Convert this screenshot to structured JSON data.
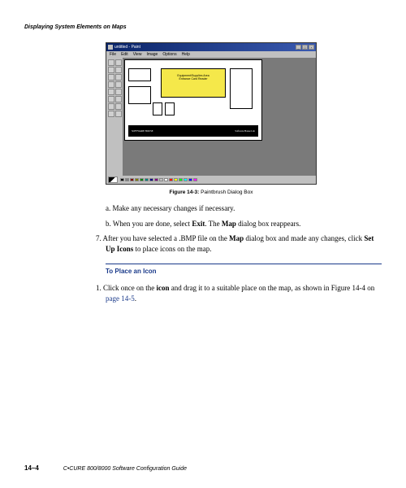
{
  "header": {
    "title": "Displaying System Elements on Maps"
  },
  "figure": {
    "window_title": "untitled - Paint",
    "menu": [
      "File",
      "Edit",
      "View",
      "Image",
      "Options",
      "Help"
    ],
    "caption_label": "Figure 14-3:",
    "caption_text": "Paintbrush Dialog Box",
    "rooms": {
      "highlight_line1": "Equipment/Supplies Area",
      "highlight_line2": "Entrance Card Reader"
    },
    "footer_left": "SOFTWARE HOUSE",
    "footer_right": "Software House Lab"
  },
  "steps": {
    "a": {
      "marker": "a.",
      "text": "Make any necessary changes if necessary."
    },
    "b": {
      "marker": "b.",
      "t1": "When you are done, select ",
      "bold1": "Exit",
      "t2": ". The ",
      "bold2": "Map",
      "t3": " dialog box reappears."
    },
    "seven": {
      "marker": "7.",
      "t1": "After you have selected a .BMP file on the ",
      "bold1": "Map",
      "t2": " dialog box and made any changes, click ",
      "bold2": "Set Up Icons",
      "t3": " to place icons on the map."
    }
  },
  "section": {
    "heading": "To Place an Icon"
  },
  "place_step": {
    "marker": "1.",
    "t1": "Click once on the ",
    "bold1": "icon",
    "t2": " and drag it to a suitable place on the map, as shown in Figure 14-4 on ",
    "link": "page 14-5",
    "t3": "."
  },
  "footer": {
    "pagenum": "14–4",
    "title": "C•CURE 800/8000 Software Configuration Guide"
  },
  "swatches": [
    "#000",
    "#808080",
    "#800000",
    "#808000",
    "#008000",
    "#008080",
    "#000080",
    "#800080",
    "#c0c0c0",
    "#fff",
    "#f00",
    "#ff0",
    "#0f0",
    "#0ff",
    "#00f",
    "#f0f"
  ]
}
